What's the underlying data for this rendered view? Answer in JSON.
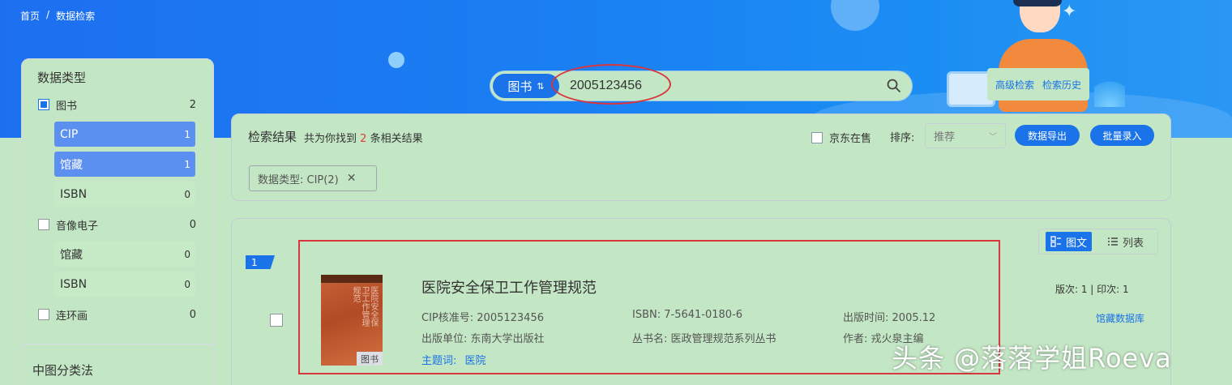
{
  "breadcrumb": {
    "home": "首页",
    "separator": "/",
    "current": "数据检索"
  },
  "search": {
    "type_label": "图书",
    "type_swap_glyph": "⇅",
    "value": "2005123456",
    "icon": "search-icon"
  },
  "quick_links": {
    "advanced": "高级检索",
    "history": "检索历史"
  },
  "sidebar": {
    "title": "数据类型",
    "categories": [
      {
        "label": "图书",
        "count": "2",
        "state": "partial",
        "children": [
          {
            "label": "CIP",
            "count": "1",
            "active": true
          },
          {
            "label": "馆藏",
            "count": "1",
            "active": true
          },
          {
            "label": "ISBN",
            "count": "0",
            "active": false
          }
        ]
      },
      {
        "label": "音像电子",
        "count": "0",
        "state": "unchecked",
        "children": [
          {
            "label": "馆藏",
            "count": "0",
            "active": false
          },
          {
            "label": "ISBN",
            "count": "0",
            "active": false
          }
        ]
      },
      {
        "label": "连环画",
        "count": "0",
        "state": "unchecked",
        "children": []
      }
    ],
    "section2_title": "中图分类法"
  },
  "results": {
    "title": "检索结果",
    "summary_prefix": "共为你找到",
    "summary_count": "2",
    "summary_suffix": "条相关结果",
    "jd_label": "京东在售",
    "sort_label": "排序:",
    "sort_value": "推荐",
    "export_label": "数据导出",
    "batch_label": "批量录入",
    "filter_tag": "数据类型: CIP(2)",
    "filter_close": "✕"
  },
  "view_toggle": {
    "graphic": "图文",
    "list": "列表"
  },
  "items": [
    {
      "index": "1",
      "cover_badge": "图书",
      "cover_text": "医院安全保卫工作管理规范",
      "title": "医院安全保卫工作管理规范",
      "cip_key": "CIP核准号:",
      "cip": "2005123456",
      "isbn_key": "ISBN:",
      "isbn": "7-5641-0180-6",
      "date_key": "出版时间:",
      "date": "2005.12",
      "publisher_key": "出版单位:",
      "publisher": "东南大学出版社",
      "series_key": "丛书名:",
      "series": "医政管理规范系列丛书",
      "author_key": "作者:",
      "author": "戎火泉主编",
      "subject_key": "主题词:",
      "subject": "医院",
      "edition": "版次: 1  |  印次: 1",
      "holdings_link": "馆藏数据库"
    }
  ],
  "watermark": "头条 @落落学姐Roeva",
  "colors": {
    "accent": "#1a73e8",
    "highlight_red": "#d9363e",
    "banner": "#1a7ff2"
  }
}
